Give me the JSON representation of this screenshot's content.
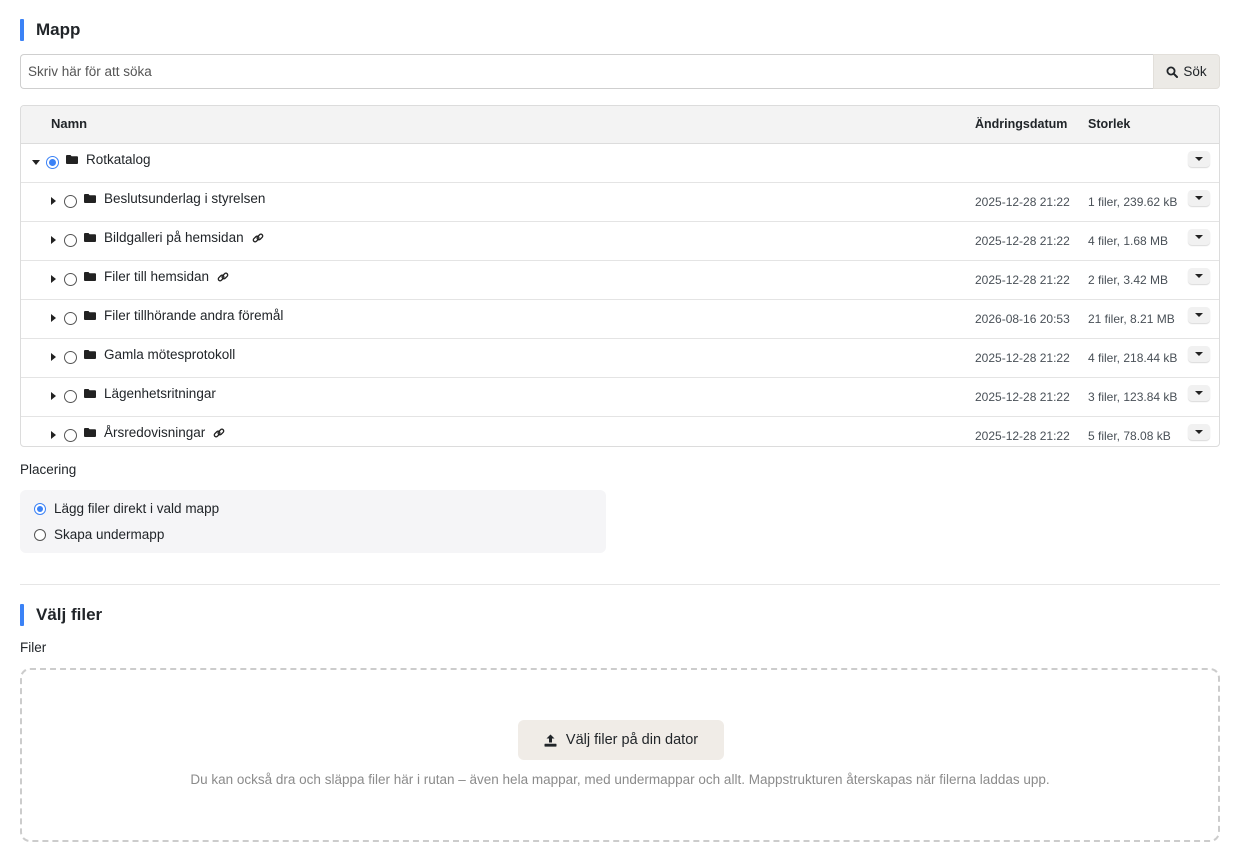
{
  "folder_section": {
    "title": "Mapp"
  },
  "search": {
    "placeholder": "Skriv här för att söka",
    "button_label": "Sök"
  },
  "tree": {
    "columns": {
      "name": "Namn",
      "modified": "Ändringsdatum",
      "size": "Storlek"
    },
    "root": {
      "name": "Rotkatalog",
      "selected": true,
      "expanded": true
    },
    "items": [
      {
        "name": "Beslutsunderlag i styrelsen",
        "modified": "2025-12-28 21:22",
        "size": "1 filer, 239.62 kB",
        "linked": false
      },
      {
        "name": "Bildgalleri på hemsidan",
        "modified": "2025-12-28 21:22",
        "size": "4 filer, 1.68 MB",
        "linked": true
      },
      {
        "name": "Filer till hemsidan",
        "modified": "2025-12-28 21:22",
        "size": "2 filer, 3.42 MB",
        "linked": true
      },
      {
        "name": "Filer tillhörande andra föremål",
        "modified": "2026-08-16 20:53",
        "size": "21 filer, 8.21 MB",
        "linked": false
      },
      {
        "name": "Gamla mötesprotokoll",
        "modified": "2025-12-28 21:22",
        "size": "4 filer, 218.44 kB",
        "linked": false
      },
      {
        "name": "Lägenhetsritningar",
        "modified": "2025-12-28 21:22",
        "size": "3 filer, 123.84 kB",
        "linked": false
      },
      {
        "name": "Årsredovisningar",
        "modified": "2025-12-28 21:22",
        "size": "5 filer, 78.08 kB",
        "linked": true
      }
    ]
  },
  "placement": {
    "label": "Placering",
    "options": [
      {
        "label": "Lägg filer direkt i vald mapp",
        "selected": true
      },
      {
        "label": "Skapa undermapp",
        "selected": false
      }
    ]
  },
  "files_section": {
    "title": "Välj filer",
    "field_label": "Filer",
    "pick_button": "Välj filer på din dator",
    "hint": "Du kan också dra och släppa filer här i rutan – även hela mappar, med undermappar och allt. Mappstrukturen återskapas när filerna laddas upp."
  },
  "colors": {
    "accent": "#3b82f6"
  }
}
